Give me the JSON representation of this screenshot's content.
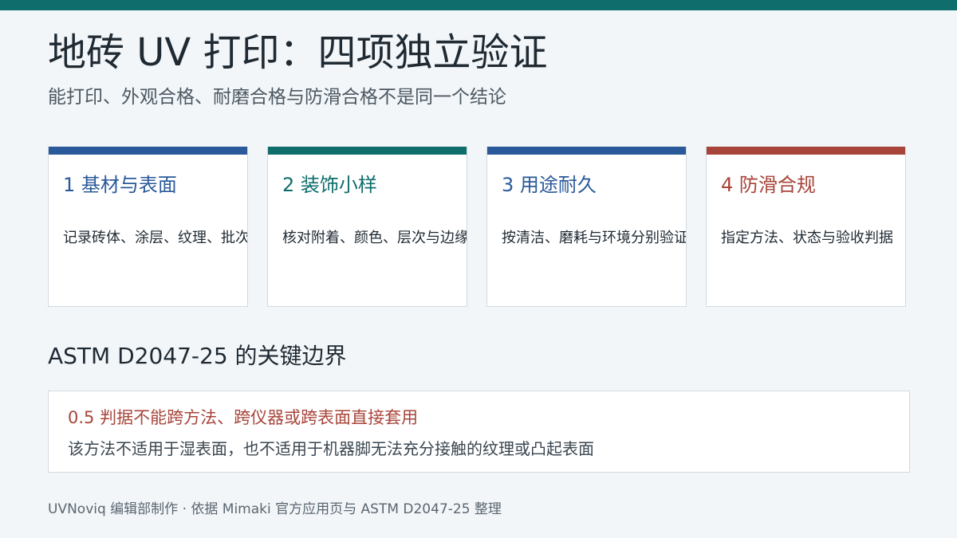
{
  "header": {
    "title": "地砖 UV 打印：四项独立验证",
    "subtitle": "能打印、外观合格、耐磨合格与防滑合格不是同一个结论"
  },
  "colors": {
    "teal": "#0f6e6c",
    "blue": "#2b5a9a",
    "red": "#a8453a"
  },
  "cards": [
    {
      "title": "1  基材与表面",
      "desc": "记录砖体、涂层、纹理、批次",
      "accent": "#2b5a9a"
    },
    {
      "title": "2  装饰小样",
      "desc": "核对附着、颜色、层次与边缘",
      "accent": "#0f6e6c"
    },
    {
      "title": "3  用途耐久",
      "desc": "按清洁、磨耗与环境分别验证",
      "accent": "#2b5a9a"
    },
    {
      "title": "4  防滑合规",
      "desc": "指定方法、状态与验收判据",
      "accent": "#a8453a"
    }
  ],
  "section": {
    "title": "ASTM D2047-25 的关键边界"
  },
  "note": {
    "headline": "0.5 判据不能跨方法、跨仪器或跨表面直接套用",
    "body": "该方法不适用于湿表面，也不适用于机器脚无法充分接触的纹理或凸起表面"
  },
  "footer": {
    "text": "UVNoviq 编辑部制作 · 依据 Mimaki 官方应用页与 ASTM D2047-25 整理"
  }
}
